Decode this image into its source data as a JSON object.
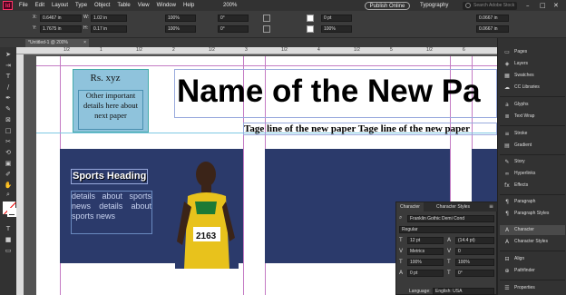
{
  "menubar": {
    "logo": "Id",
    "items": [
      "File",
      "Edit",
      "Layout",
      "Type",
      "Object",
      "Table",
      "View",
      "Window",
      "Help"
    ],
    "zoom": "200%",
    "publish": "Publish Online",
    "workspace": "Typography",
    "search_placeholder": "Search Adobe Stock"
  },
  "control": {
    "x_label": "X:",
    "x_value": "0.6467 in",
    "y_label": "Y:",
    "y_value": "1.7675 in",
    "w_label": "W:",
    "w_value": "1.02 in",
    "h_label": "H:",
    "h_value": "0.17 in",
    "scale_x": "100%",
    "scale_y": "100%",
    "angle": "0°",
    "shear": "0°",
    "stroke": "0 pt",
    "opacity": "100%",
    "offset1": "0.0667 in",
    "offset2": "0.0667 in"
  },
  "tab": {
    "label": "*Untitled-1 @ 200%",
    "close": "×"
  },
  "ruler": {
    "marks": [
      "1/2",
      "1",
      "1/2",
      "2",
      "1/2",
      "3",
      "1/2",
      "4",
      "1/2",
      "5",
      "1/2",
      "6",
      "1/2"
    ]
  },
  "page": {
    "rs": "Rs. xyz",
    "other": "Other important details here about next paper",
    "title": "Name of the New Pa",
    "tagline": "Tage line of the new paper Tage line of the new paper",
    "sports_heading": "Sports Heading",
    "details": "details about sports news details about sports news"
  },
  "character": {
    "tab1": "Character",
    "tab2": "Character Styles",
    "font": "Franklin Gothic Demi Cond",
    "style": "Regular",
    "size": "12 pt",
    "leading": "(14.4 pt)",
    "kerning": "Metrics",
    "tracking": "0",
    "vscale": "100%",
    "hscale": "100%",
    "baseline": "0 pt",
    "skew": "0°",
    "language_label": "Language:",
    "language": "English: USA"
  },
  "rpanel": {
    "items": [
      {
        "label": "Pages",
        "icon": "▭"
      },
      {
        "label": "Layers",
        "icon": "◈"
      },
      {
        "label": "Swatches",
        "icon": "▦"
      },
      {
        "label": "CC Libraries",
        "icon": "☁"
      },
      {
        "label": "Glyphs",
        "icon": "a"
      },
      {
        "label": "Text Wrap",
        "icon": "≣"
      },
      {
        "label": "Stroke",
        "icon": "≡"
      },
      {
        "label": "Gradient",
        "icon": "▤"
      },
      {
        "label": "Story",
        "icon": "✎"
      },
      {
        "label": "Hyperlinks",
        "icon": "∞"
      },
      {
        "label": "Effects",
        "icon": "fx"
      },
      {
        "label": "Paragraph",
        "icon": "¶"
      },
      {
        "label": "Paragraph Styles",
        "icon": "¶"
      },
      {
        "label": "Character",
        "icon": "A"
      },
      {
        "label": "Character Styles",
        "icon": "A"
      },
      {
        "label": "Align",
        "icon": "⊟"
      },
      {
        "label": "Pathfinder",
        "icon": "⊕"
      },
      {
        "label": "Properties",
        "icon": "☰"
      }
    ]
  }
}
